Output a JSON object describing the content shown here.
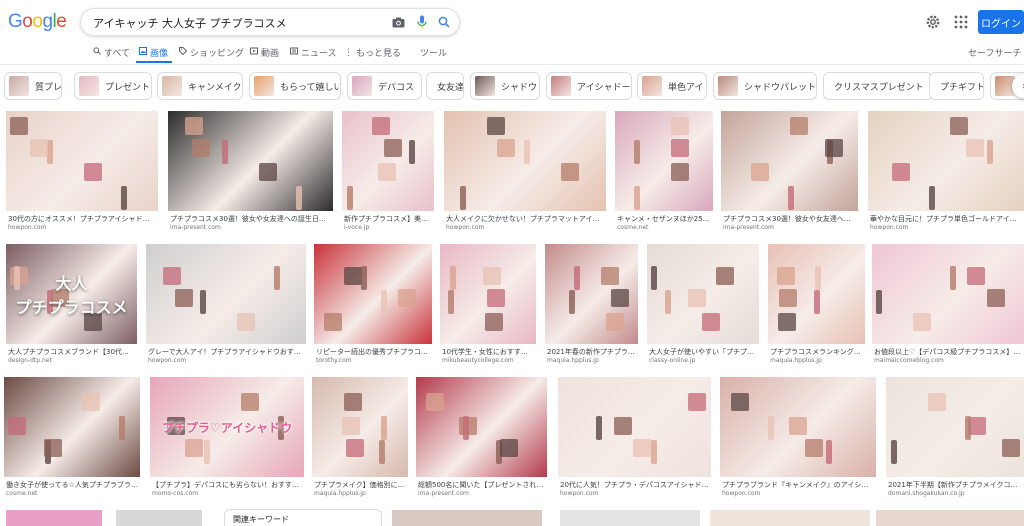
{
  "search": {
    "query": "アイキャッチ 大人女子 プチプラコスメ"
  },
  "header": {
    "login_label": "ログイン"
  },
  "tabs": [
    {
      "label": "すべて",
      "icon": "search-icon"
    },
    {
      "label": "画像",
      "icon": "image-icon",
      "active": true
    },
    {
      "label": "ショッピング",
      "icon": "tag-icon"
    },
    {
      "label": "動画",
      "icon": "video-icon"
    },
    {
      "label": "ニュース",
      "icon": "news-icon"
    },
    {
      "label": "もっと見る",
      "icon": "more-icon"
    },
    {
      "label": "ツール",
      "icon": ""
    }
  ],
  "safe_search": "セーフサーチ ▾",
  "chips": [
    {
      "label": "質プレ",
      "thumb": "#c9a9a6"
    },
    {
      "label": "プレゼント",
      "thumb": "#e7b9c3"
    },
    {
      "label": "キャンメイク",
      "thumb": "#d7b8a4"
    },
    {
      "label": "もらって嬉しい",
      "thumb": "#e5a26a"
    },
    {
      "label": "デパコス",
      "thumb": "#d8a4c0"
    },
    {
      "label": "女友達",
      "thumb": ""
    },
    {
      "label": "シャドウ",
      "thumb": "#6d5a55"
    },
    {
      "label": "アイシャドー",
      "thumb": "#c57e7e"
    },
    {
      "label": "単色アイ",
      "thumb": "#d6a48e"
    },
    {
      "label": "シャドウパレット",
      "thumb": "#b98a7a"
    },
    {
      "label": "クリスマスプレゼント",
      "thumb": ""
    },
    {
      "label": "プチギフト",
      "thumb": ""
    },
    {
      "label": "",
      "thumb": "#c98c6c"
    }
  ],
  "related_label": "関連キーワード",
  "rows": [
    [
      {
        "title": "30代の方にオススメ！プチプラアイシャドウお...",
        "source": "howpon.com",
        "color": "#e8d2c8",
        "overlay": ""
      },
      {
        "title": "プチプラコスメ30選！彼女や女友達への誕生日プ...",
        "source": "ima-present.com",
        "color": "#2c2c2c",
        "overlay": ""
      },
      {
        "title": "新作プチプラコスメ】美容...",
        "source": "i-voce.jp",
        "color": "#e9c1cb",
        "overlay": ""
      },
      {
        "title": "大人メイクに欠かせない！プチプラマットアイシ...",
        "source": "howpon.com",
        "color": "#e4c2b0",
        "overlay": ""
      },
      {
        "title": "キャンメ・セザンヌほか25...",
        "source": "cosme.net",
        "color": "#d9a7bc",
        "overlay": ""
      },
      {
        "title": "プチプラコスメ30選！彼女や女友達への...",
        "source": "ima-present.com",
        "color": "#c3a49a",
        "overlay": ""
      },
      {
        "title": "華やかな目元に！プチプラ単色ゴールドアイシ...",
        "source": "howpon.com",
        "color": "#e4d2bf",
        "overlay": ""
      }
    ],
    [
      {
        "title": "大人プチプラコスメブランド【30代・40...",
        "source": "design-dtp.net",
        "color": "#7c5d62",
        "overlay": "大人\nプチプラコスメ"
      },
      {
        "title": "グレーで大人アイ！プチプラアイシャドウおすす...",
        "source": "howpon.com",
        "color": "#cfcfcf",
        "overlay": ""
      },
      {
        "title": "リピーター続出の優秀プチプラコ...",
        "source": "torothy.com",
        "color": "#c8333a",
        "overlay": ""
      },
      {
        "title": "10代学生・女性におすすめ\"...",
        "source": "mikubeautycollege.com",
        "color": "#e9b7c4",
        "overlay": ""
      },
      {
        "title": "2021年春の新作プチプラコ...",
        "source": "maquia.hpplus.jp",
        "color": "#c28b8b",
        "overlay": ""
      },
      {
        "title": "大人女子が使いやすい「プチプラ...",
        "source": "classy-online.jp",
        "color": "#e6dcd6",
        "overlay": ""
      },
      {
        "title": "プチプラコスメランキング...",
        "source": "maquia.hpplus.jp",
        "color": "#e8c0b5",
        "overlay": ""
      },
      {
        "title": "お値段以上♡【デパコス級プチプラコスメ】8...",
        "source": "maimaiccomeblog.com",
        "color": "#f0c6d5",
        "overlay": ""
      }
    ],
    [
      {
        "title": "働き女子が使ってる☆人気プチプラブラン...",
        "source": "cosme.net",
        "color": "#6c4a43",
        "overlay": ""
      },
      {
        "title": "【プチプラ】デパコスにも劣らない！おすすめの...",
        "source": "momo-cos.com",
        "color": "#e7a6b9",
        "overlay": "プチプラ♡アイシャドウ"
      },
      {
        "title": "プチプラメイク】価格別に...",
        "source": "maquia.hpplus.jp",
        "color": "#d6b9ad",
        "overlay": ""
      },
      {
        "title": "総額500名に聞いた【プレゼントされた...",
        "source": "ima-present.com",
        "color": "#b33a4c",
        "overlay": ""
      },
      {
        "title": "20代に人気！プチプラ・デパコスアイシャドウ...",
        "source": "howpon.com",
        "color": "#efe3de",
        "overlay": ""
      },
      {
        "title": "プチプラブランド『キャンメイク』のアイシャ...",
        "source": "howpon.com",
        "color": "#d9b0a8",
        "overlay": ""
      },
      {
        "title": "2021年下半期【新作プチプラメイクコス...",
        "source": "domani.shogakukan.co.jp",
        "color": "#ece4dc",
        "overlay": ""
      }
    ]
  ]
}
